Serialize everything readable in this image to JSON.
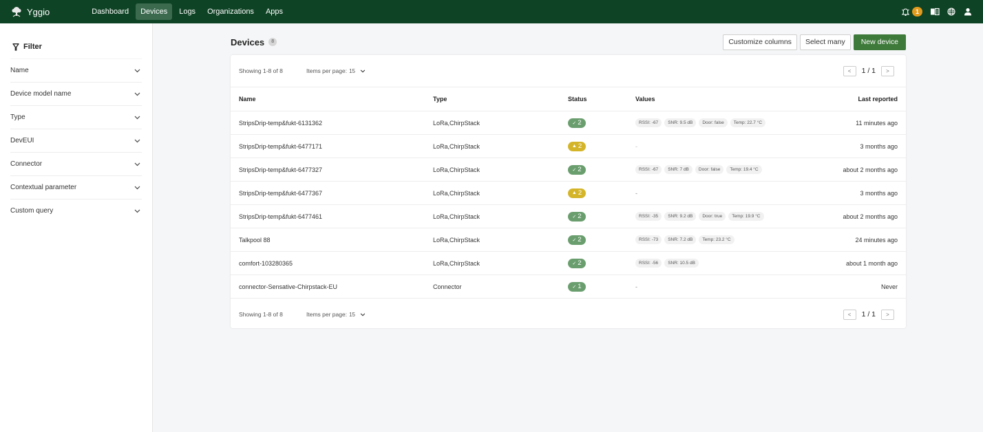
{
  "app": {
    "name": "Yggio",
    "nav": [
      {
        "label": "Dashboard",
        "active": false
      },
      {
        "label": "Devices",
        "active": true
      },
      {
        "label": "Logs",
        "active": false
      },
      {
        "label": "Organizations",
        "active": false
      },
      {
        "label": "Apps",
        "active": false
      }
    ],
    "notifications_count": "1",
    "icons": [
      "bell-icon",
      "book-icon",
      "globe-icon",
      "user-icon"
    ],
    "colors": {
      "topbar": "#0f4325",
      "primary": "#3e7a3a",
      "ok": "#6a9e6e",
      "warn": "#d4b52a",
      "badge": "#e29b1c"
    }
  },
  "sidebar": {
    "filter_title": "Filter",
    "filters": [
      {
        "label": "Name"
      },
      {
        "label": "Device model name"
      },
      {
        "label": "Type"
      },
      {
        "label": "DevEUI"
      },
      {
        "label": "Connector"
      },
      {
        "label": "Contextual parameter"
      },
      {
        "label": "Custom query"
      }
    ]
  },
  "main": {
    "title": "Devices",
    "count": "8",
    "buttons": {
      "customize": "Customize columns",
      "select_many": "Select many",
      "new_device": "New device"
    },
    "pagination": {
      "showing": "Showing 1-8 of 8",
      "items_per_page_label": "Items per page:",
      "items_per_page_value": "15",
      "page": "1 / 1",
      "prev": "<",
      "next": ">"
    },
    "columns": {
      "name": "Name",
      "type": "Type",
      "status": "Status",
      "values": "Values",
      "last_reported": "Last reported"
    },
    "rows": [
      {
        "name": "StripsDrip-temp&fukt-6131362",
        "type": "LoRa,ChirpStack",
        "status": "ok",
        "status_count": "2",
        "values": [
          "RSSI: -67",
          "SNR: 9.5 dB",
          "Door: false",
          "Temp: 22.7 °C"
        ],
        "values_empty": "",
        "last": "11 minutes ago"
      },
      {
        "name": "StripsDrip-temp&fukt-6477171",
        "type": "LoRa,ChirpStack",
        "status": "warn",
        "status_count": "2",
        "values": [],
        "values_empty": "-",
        "last": "3 months ago"
      },
      {
        "name": "StripsDrip-temp&fukt-6477327",
        "type": "LoRa,ChirpStack",
        "status": "ok",
        "status_count": "2",
        "values": [
          "RSSI: -67",
          "SNR: 7 dB",
          "Door: false",
          "Temp: 19.4 °C"
        ],
        "values_empty": "",
        "last": "about 2 months ago"
      },
      {
        "name": "StripsDrip-temp&fukt-6477367",
        "type": "LoRa,ChirpStack",
        "status": "warn",
        "status_count": "2",
        "values": [],
        "values_empty": "-",
        "last": "3 months ago"
      },
      {
        "name": "StripsDrip-temp&fukt-6477461",
        "type": "LoRa,ChirpStack",
        "status": "ok",
        "status_count": "2",
        "values": [
          "RSSI: -35",
          "SNR: 9.2 dB",
          "Door: true",
          "Temp: 19.9 °C"
        ],
        "values_empty": "",
        "last": "about 2 months ago"
      },
      {
        "name": "Talkpool 88",
        "type": "LoRa,ChirpStack",
        "status": "ok",
        "status_count": "2",
        "values": [
          "RSSI: -73",
          "SNR: 7.2 dB",
          "Temp: 23.2 °C"
        ],
        "values_empty": "",
        "last": "24 minutes ago"
      },
      {
        "name": "comfort-103280365",
        "type": "LoRa,ChirpStack",
        "status": "ok",
        "status_count": "2",
        "values": [
          "RSSI: -56",
          "SNR: 10.5 dB"
        ],
        "values_empty": "",
        "last": "about 1 month ago"
      },
      {
        "name": "connector-Sensative-Chirpstack-EU",
        "type": "Connector",
        "status": "ok",
        "status_count": "1",
        "values": [],
        "values_empty": "-",
        "last": "Never"
      }
    ]
  }
}
